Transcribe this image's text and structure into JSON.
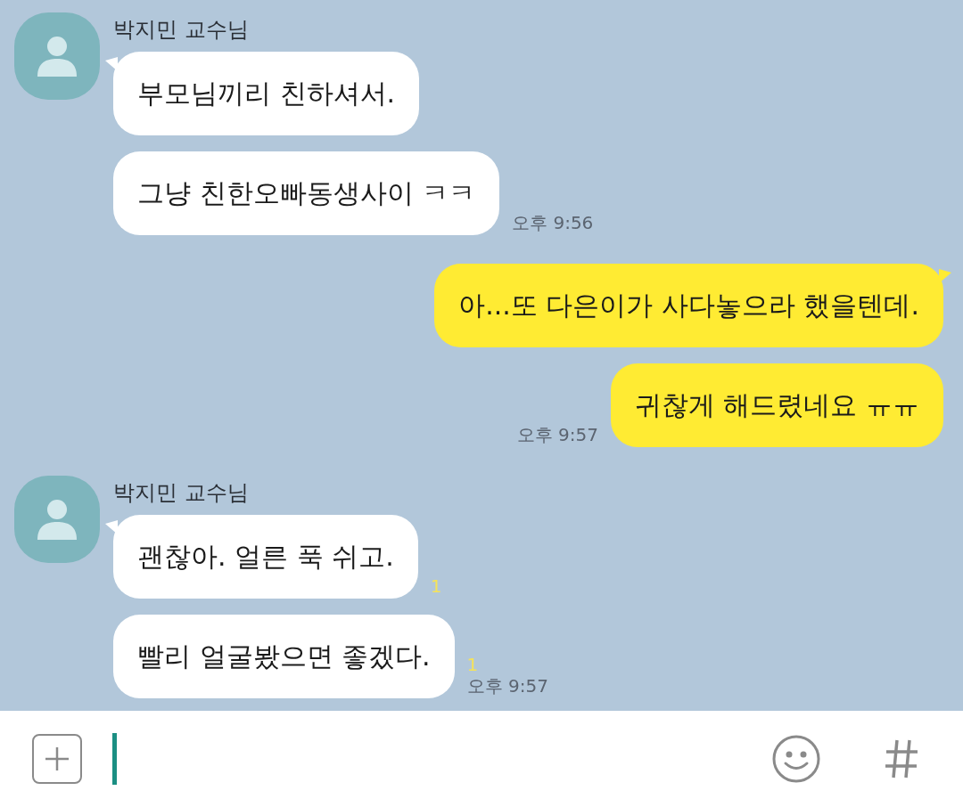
{
  "chat": [
    {
      "kind": "incoming",
      "sender": "박지민 교수님",
      "messages": [
        {
          "text": "부모님끼리 친하셔서."
        },
        {
          "text": "그냥 친한오빠동생사이 ㅋㅋ",
          "time": "오후 9:56"
        }
      ]
    },
    {
      "kind": "outgoing",
      "messages": [
        {
          "text": "아...또 다은이가 사다놓으라 했을텐데."
        },
        {
          "text": "귀찮게 해드렸네요 ㅠㅠ",
          "time": "오후 9:57"
        }
      ]
    },
    {
      "kind": "incoming",
      "sender": "박지민 교수님",
      "messages": [
        {
          "text": "괜찮아. 얼른 푹 쉬고.",
          "unread": "1"
        },
        {
          "text": "빨리 얼굴봤으면 좋겠다.",
          "unread": "1",
          "time": "오후 9:57"
        }
      ]
    }
  ]
}
